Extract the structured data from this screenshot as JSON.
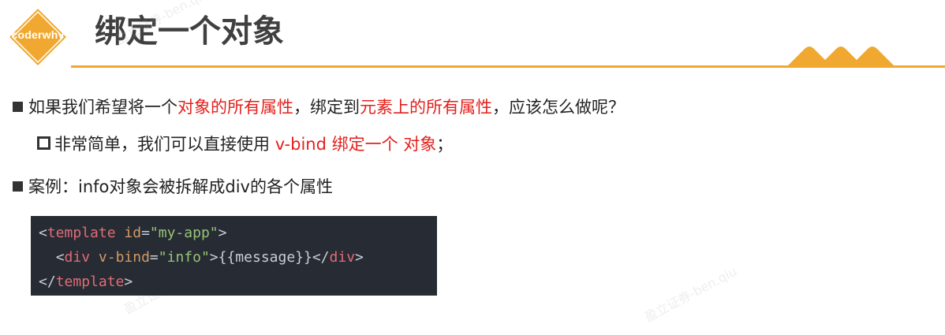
{
  "logo": {
    "text": "coderwhy"
  },
  "title": "绑定一个对象",
  "bullets": [
    {
      "parts": [
        "如果我们希望将一个",
        "对象的所有属性",
        "，绑定到",
        "元素上的所有属性",
        "，应该怎么做呢？"
      ]
    },
    {
      "parts": [
        "非常简单，我们可以直接使用 ",
        "v-bind 绑定一个 对象",
        "；"
      ]
    },
    {
      "text": "案例：info对象会被拆解成div的各个属性"
    }
  ],
  "code": {
    "line1": {
      "open": "<",
      "tag": "template",
      "attr": "id",
      "eq": "=",
      "val": "\"my-app\"",
      "close": ">"
    },
    "line2": {
      "open": "<",
      "tag": "div",
      "attr": "v-bind",
      "eq": "=",
      "val": "\"info\"",
      "content": ">{{message}}</",
      "tag2": "div",
      "close": ">"
    },
    "line3": {
      "open": "</",
      "tag": "template",
      "close": ">"
    }
  },
  "watermarks": [
    "盈立证券-ben.qiu",
    "盈立证券-ben.qiu",
    "盈立证券-ben.qiu"
  ],
  "colors": {
    "accent": "#f0a830",
    "highlight": "#e3201c",
    "code_bg": "#272b33"
  }
}
